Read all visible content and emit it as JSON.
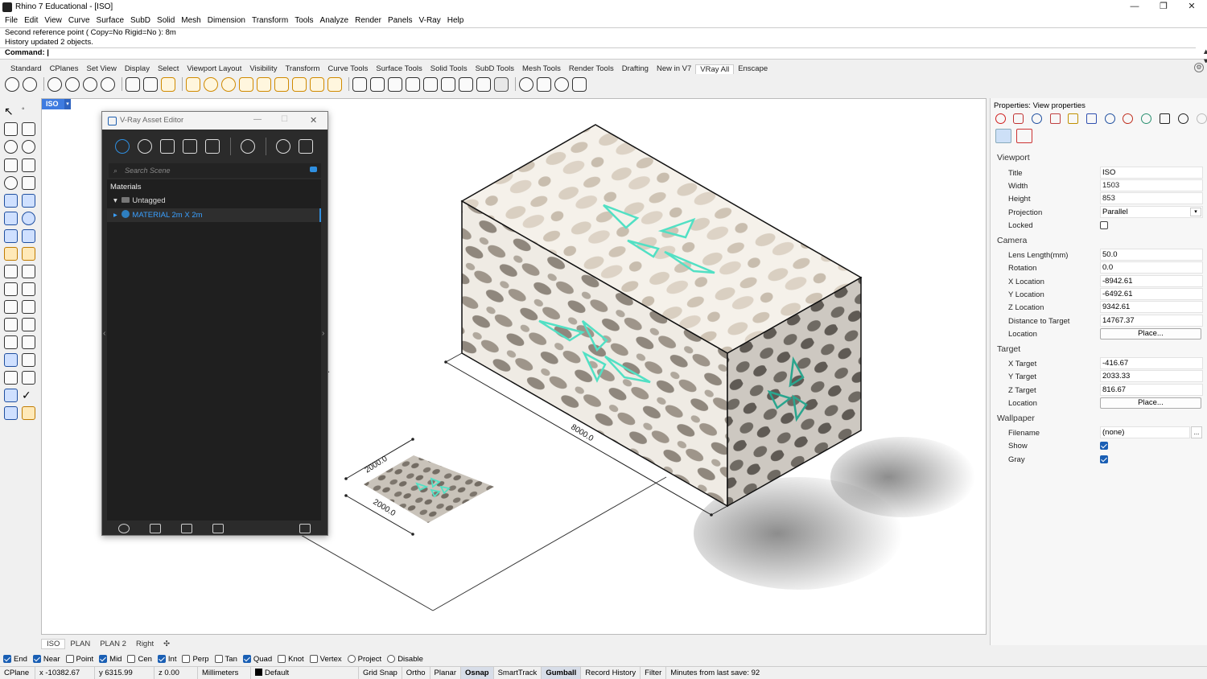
{
  "window": {
    "title": "Rhino 7 Educational - [ISO]"
  },
  "menu": [
    "File",
    "Edit",
    "View",
    "Curve",
    "Surface",
    "SubD",
    "Solid",
    "Mesh",
    "Dimension",
    "Transform",
    "Tools",
    "Analyze",
    "Render",
    "Panels",
    "V-Ray",
    "Help"
  ],
  "command": {
    "history": [
      "Second reference point ( Copy=No  Rigid=No ): 8m",
      "History updated 2 objects."
    ],
    "prompt": "Command:"
  },
  "toolbar_tabs": [
    "Standard",
    "CPlanes",
    "Set View",
    "Display",
    "Select",
    "Viewport Layout",
    "Visibility",
    "Transform",
    "Curve Tools",
    "Surface Tools",
    "Solid Tools",
    "SubD Tools",
    "Mesh Tools",
    "Render Tools",
    "Drafting",
    "New in V7",
    "VRay All",
    "Enscape"
  ],
  "active_tab": "VRay All",
  "viewport": {
    "name": "ISO",
    "dims": {
      "d1": "2000.0",
      "d2": "2000.0",
      "d3": "8000.0"
    },
    "tabs": [
      "ISO",
      "PLAN",
      "PLAN 2",
      "Right"
    ]
  },
  "vray_editor": {
    "title": "V-Ray Asset Editor",
    "search_placeholder": "Search Scene",
    "section": "Materials",
    "group": "Untagged",
    "material": "MATERIAL 2m X 2m"
  },
  "properties": {
    "header": "Properties: View properties",
    "viewport_section": "Viewport",
    "camera_section": "Camera",
    "target_section": "Target",
    "wallpaper_section": "Wallpaper",
    "viewport_rows": [
      {
        "label": "Title",
        "value": "ISO"
      },
      {
        "label": "Width",
        "value": "1503"
      },
      {
        "label": "Height",
        "value": "853"
      },
      {
        "label": "Projection",
        "value": "Parallel"
      }
    ],
    "locked_label": "Locked",
    "camera_rows": [
      {
        "label": "Lens Length(mm)",
        "value": "50.0"
      },
      {
        "label": "Rotation",
        "value": "0.0"
      },
      {
        "label": "X Location",
        "value": "-8942.61"
      },
      {
        "label": "Y Location",
        "value": "-6492.61"
      },
      {
        "label": "Z Location",
        "value": "9342.61"
      },
      {
        "label": "Distance to Target",
        "value": "14767.37"
      }
    ],
    "location_label": "Location",
    "place_button": "Place...",
    "target_rows": [
      {
        "label": "X Target",
        "value": "-416.67"
      },
      {
        "label": "Y Target",
        "value": "2033.33"
      },
      {
        "label": "Z Target",
        "value": "816.67"
      }
    ],
    "filename_label": "Filename",
    "filename_value": "(none)",
    "filename_browse": "...",
    "show_label": "Show",
    "gray_label": "Gray"
  },
  "osnaps": [
    {
      "label": "End",
      "on": true
    },
    {
      "label": "Near",
      "on": true
    },
    {
      "label": "Point",
      "on": false
    },
    {
      "label": "Mid",
      "on": true
    },
    {
      "label": "Cen",
      "on": false
    },
    {
      "label": "Int",
      "on": true
    },
    {
      "label": "Perp",
      "on": false
    },
    {
      "label": "Tan",
      "on": false
    },
    {
      "label": "Quad",
      "on": true
    },
    {
      "label": "Knot",
      "on": false
    },
    {
      "label": "Vertex",
      "on": false
    },
    {
      "label": "Project",
      "on": false
    },
    {
      "label": "Disable",
      "on": false
    }
  ],
  "status": {
    "cplane": "CPlane",
    "x": "x -10382.67",
    "y": "y 6315.99",
    "z": "z 0.00",
    "units": "Millimeters",
    "layer": "Default",
    "gridsnap": "Grid Snap",
    "ortho": "Ortho",
    "planar": "Planar",
    "osnap": "Osnap",
    "smarttrack": "SmartTrack",
    "gumball": "Gumball",
    "record": "Record History",
    "filter": "Filter",
    "save": "Minutes from last save: 92"
  },
  "colors": {
    "accent": "#3e7be0",
    "vray_bg": "#2b2b2b",
    "pattern": "#52e0c4"
  }
}
